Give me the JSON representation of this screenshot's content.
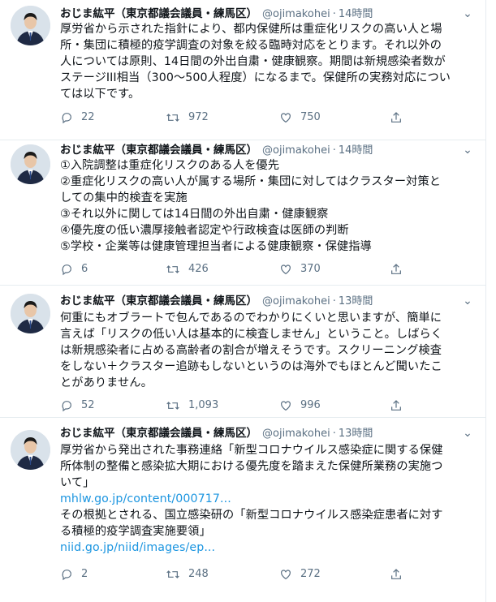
{
  "author": {
    "name": "おじま紘平（東京都議会議員・練馬区）",
    "handle": "@ojimakohei"
  },
  "tweets": [
    {
      "time": "14時間",
      "lines": [
        "厚労省から示された指針により、都内保健所は重症化リスクの高い人と場",
        "所・集団に積極的疫学調査の対象を絞る臨時対応をとります。それ以外の",
        "人については原則、14日間の外出自粛・健康観察。期間は新規感染者数が",
        "ステージIII相当（300〜500人程度）になるまで。保健所の実務対応につい",
        "ては以下です。"
      ],
      "links": [],
      "replies": "22",
      "retweets": "972",
      "likes": "750"
    },
    {
      "time": "14時間",
      "lines": [
        "①入院調整は重症化リスクのある人を優先",
        "②重症化リスクの高い人が属する場所・集団に対してはクラスター対策と",
        "しての集中的検査を実施",
        "③それ以外に関しては14日間の外出自粛・健康観察",
        "④優先度の低い濃厚接触者認定や行政検査は医師の判断",
        "⑤学校・企業等は健康管理担当者による健康観察・保健指導"
      ],
      "links": [],
      "replies": "6",
      "retweets": "426",
      "likes": "370"
    },
    {
      "time": "13時間",
      "lines": [
        "何重にもオブラートで包んであるのでわかりにくいと思いますが、簡単に",
        "言えば「リスクの低い人は基本的に検査しません」ということ。しばらく",
        "は新規感染者に占める高齢者の割合が増えそうです。スクリーニング検査",
        "をしない＋クラスター追跡もしないというのは海外でもほとんど聞いたこ",
        "とがありません。"
      ],
      "links": [],
      "replies": "52",
      "retweets": "1,093",
      "likes": "996"
    },
    {
      "time": "13時間",
      "lines": [
        "厚労省から発出された事務連絡「新型コロナウイルス感染症に関する保健",
        "所体制の整備と感染拡大期における優先度を踏まえた保健所業務の実施つ",
        "いて」"
      ],
      "link1": "mhlw.go.jp/content/000717...",
      "lines2": [
        "その根拠とされる、国立感染研の「新型コロナウイルス感染症患者に対す",
        "る積極的疫学調査実施要領」"
      ],
      "link2": "niid.go.jp/niid/images/ep...",
      "replies": "2",
      "retweets": "248",
      "likes": "272"
    }
  ],
  "colors": {
    "text": "#0f1419",
    "secondary": "#5b7083",
    "link": "#1b95e0",
    "border": "#e6ecf0"
  },
  "icons": [
    "reply-icon",
    "retweet-icon",
    "like-icon",
    "share-icon",
    "more-icon"
  ]
}
